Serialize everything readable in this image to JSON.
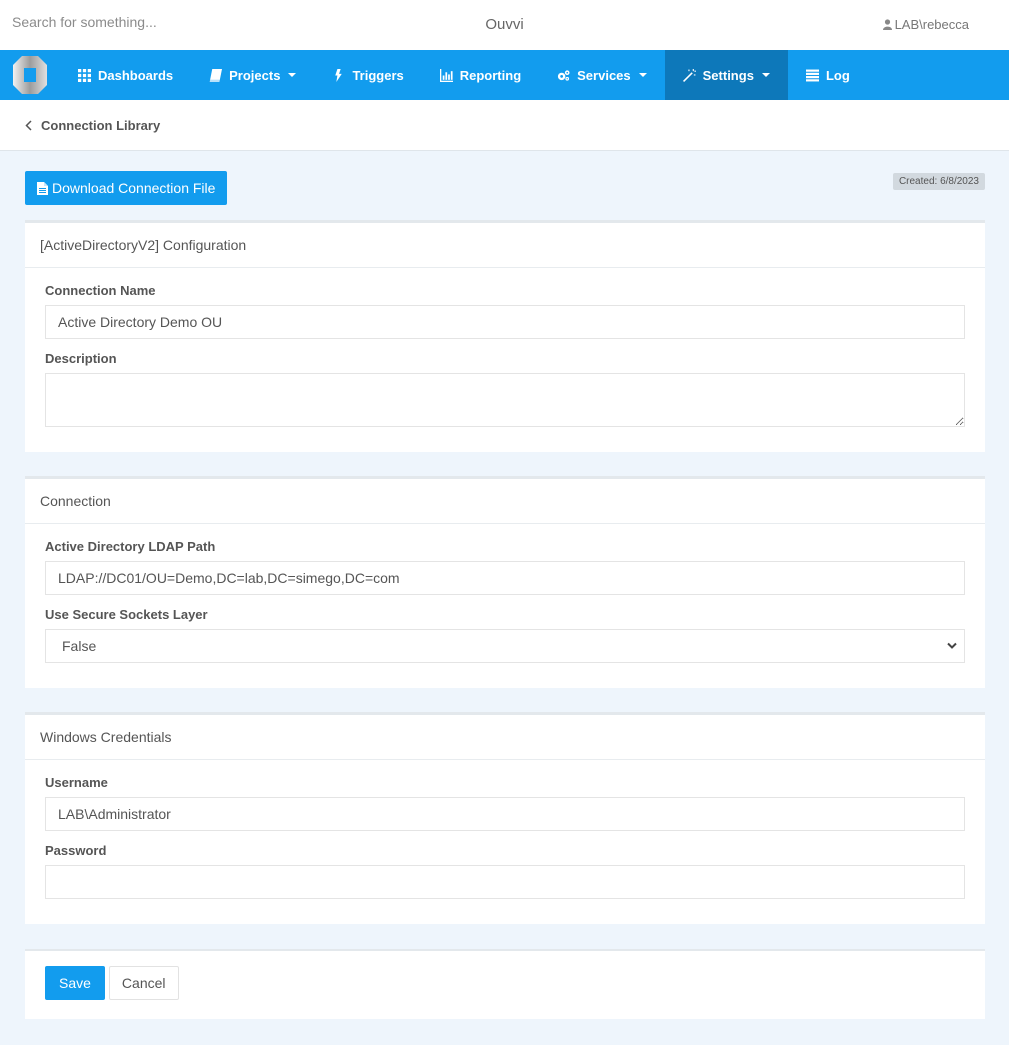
{
  "header": {
    "search_placeholder": "Search for something...",
    "app_title": "Ouvvi",
    "user": "LAB\\rebecca",
    "user_icon": "user-icon"
  },
  "nav": {
    "logo": "ouvvi-logo",
    "items": [
      {
        "label": "Dashboards",
        "icon": "grid-icon",
        "dropdown": false,
        "active": false
      },
      {
        "label": "Projects",
        "icon": "book-icon",
        "dropdown": true,
        "active": false
      },
      {
        "label": "Triggers",
        "icon": "bolt-icon",
        "dropdown": false,
        "active": false
      },
      {
        "label": "Reporting",
        "icon": "bar-chart-icon",
        "dropdown": false,
        "active": false
      },
      {
        "label": "Services",
        "icon": "cogs-icon",
        "dropdown": true,
        "active": false
      },
      {
        "label": "Settings",
        "icon": "magic-wand-icon",
        "dropdown": true,
        "active": true
      },
      {
        "label": "Log",
        "icon": "list-icon",
        "dropdown": false,
        "active": false
      }
    ]
  },
  "breadcrumb": {
    "back_label": "Connection Library"
  },
  "toolbar": {
    "download_label": "Download Connection File",
    "created_badge": "Created: 6/8/2023"
  },
  "panels": {
    "configuration": {
      "title": "[ActiveDirectoryV2] Configuration",
      "connection_name_label": "Connection Name",
      "connection_name_value": "Active Directory Demo OU",
      "description_label": "Description",
      "description_value": ""
    },
    "connection": {
      "title": "Connection",
      "ldap_path_label": "Active Directory LDAP Path",
      "ldap_path_value": "LDAP://DC01/OU=Demo,DC=lab,DC=simego,DC=com",
      "ssl_label": "Use Secure Sockets Layer",
      "ssl_value": "False"
    },
    "credentials": {
      "title": "Windows Credentials",
      "username_label": "Username",
      "username_value": "LAB\\Administrator",
      "password_label": "Password",
      "password_value": ""
    }
  },
  "actions": {
    "save_label": "Save",
    "cancel_label": "Cancel"
  },
  "colors": {
    "primary": "#129cee",
    "nav_active": "#0d78ba",
    "page_bg": "#eef5fc"
  }
}
